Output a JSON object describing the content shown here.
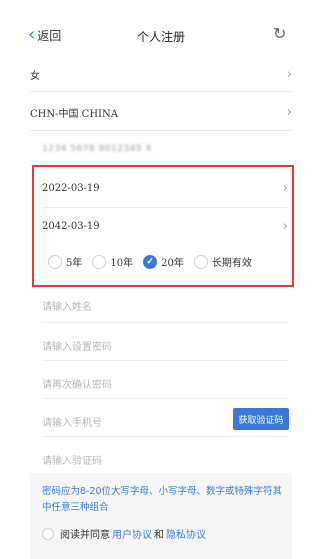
{
  "nav": {
    "back_label": "返回",
    "title": "个人注册",
    "refresh_icon": "refresh-icon"
  },
  "rows": {
    "gender": "女",
    "nationality": "CHN-中国 CHINA",
    "id_number": "1234 5678 9012345 X"
  },
  "validity": {
    "start_date": "2022-03-19",
    "end_date": "2042-03-19",
    "options": [
      "5年",
      "10年",
      "20年",
      "长期有效"
    ],
    "selected": "20年"
  },
  "inputs": {
    "name_placeholder": "请输入姓名",
    "password_placeholder": "请输入设置密码",
    "confirm_placeholder": "请再次确认密码",
    "phone_placeholder": "请输入手机号",
    "code_placeholder": "请输入验证码"
  },
  "get_code_label": "获取验证码",
  "password_hint": "密码应为8-20位大写字母、小写字母、数字或特殊字符其中任意三种组合",
  "agreement": {
    "prefix": "阅读并同意",
    "user_agreement": "用户协议",
    "and": "和",
    "privacy_agreement": "隐私协议"
  },
  "colors": {
    "accent": "#3a7ad6",
    "highlight_border": "#e23b3b"
  }
}
